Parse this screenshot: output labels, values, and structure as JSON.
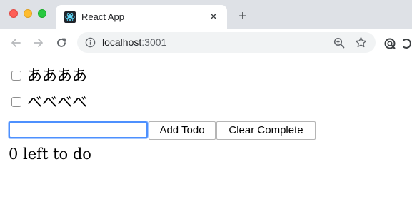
{
  "browser": {
    "tab": {
      "title": "React App",
      "close_glyph": "✕"
    },
    "new_tab_glyph": "+",
    "address": {
      "host": "localhost",
      "port": ":3001"
    },
    "colors": {
      "chrome_bg": "#dee1e6",
      "omnibox_bg": "#f1f3f4",
      "focus_ring": "#4d90fe"
    },
    "icons": [
      "back-arrow-icon",
      "forward-arrow-icon",
      "reload-icon",
      "info-icon",
      "zoom-icon",
      "bookmark-star-icon",
      "extension-icon",
      "menu-icon"
    ]
  },
  "app": {
    "todos": [
      {
        "text": "ああああ",
        "completed": false
      },
      {
        "text": "べべべべ",
        "completed": false
      }
    ],
    "input": {
      "value": "",
      "placeholder": ""
    },
    "add_button": "Add Todo",
    "clear_button": "Clear Complete",
    "left_count_text": "0 left to do"
  }
}
